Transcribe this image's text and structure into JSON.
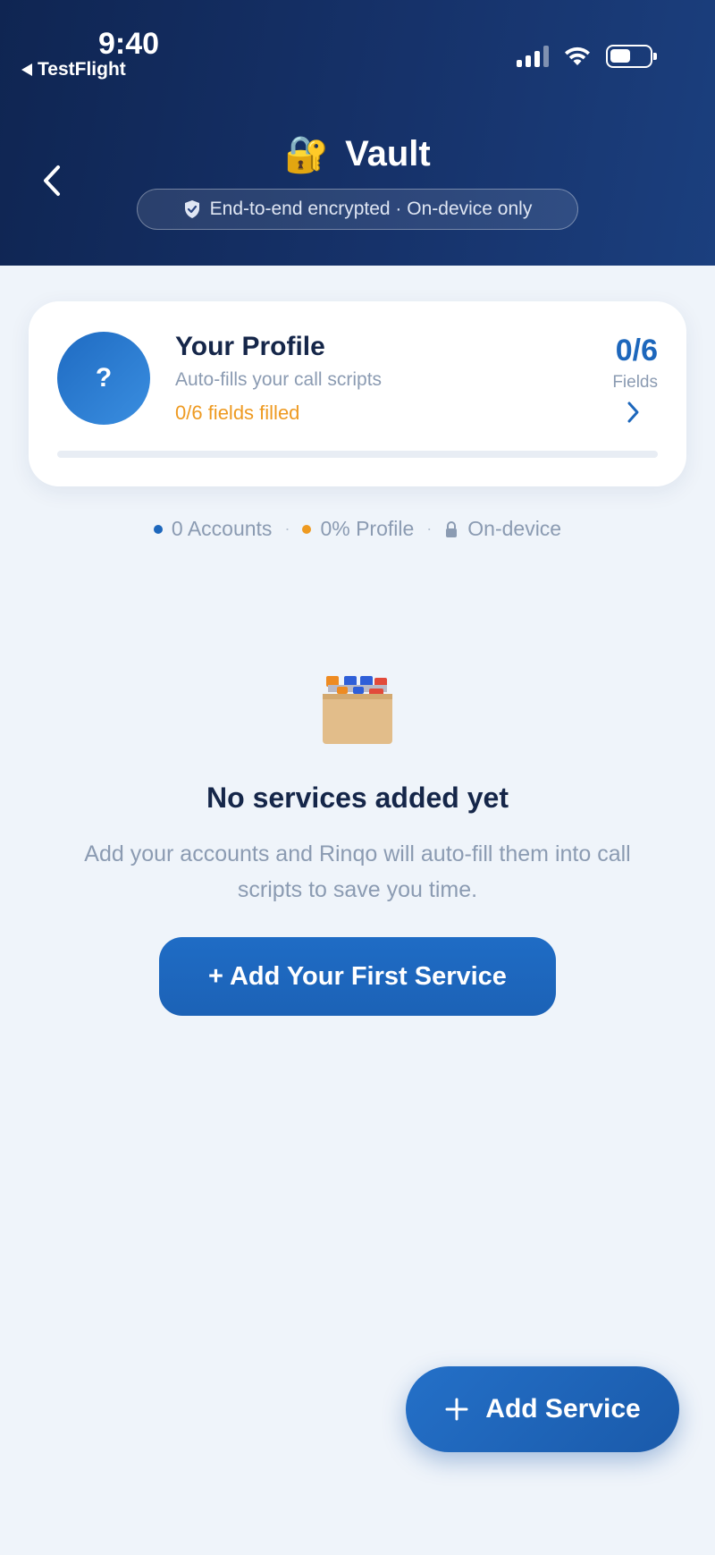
{
  "status_bar": {
    "time": "9:40",
    "back_app": "TestFlight"
  },
  "header": {
    "title": "Vault",
    "lock_emoji": "🔐",
    "encryption_note": "End-to-end encrypted · On-device only"
  },
  "profile": {
    "avatar_text": "?",
    "title": "Your Profile",
    "subtitle": "Auto-fills your call scripts",
    "filled_text": "0/6 fields filled",
    "count": "0/6",
    "count_label": "Fields",
    "progress": 0
  },
  "stats": {
    "accounts": "0 Accounts",
    "profile": "0% Profile",
    "device": "On-device",
    "separator": "·"
  },
  "empty_state": {
    "title": "No services added yet",
    "description": "Add your accounts and Rinqo will auto-fill them into call scripts to save you time.",
    "button_label": "+ Add Your First Service"
  },
  "fab": {
    "label": "Add Service"
  },
  "colors": {
    "header_bg": "#16326a",
    "accent_blue": "#1d67bc",
    "accent_orange": "#ee9a21",
    "background": "#eff4fa"
  }
}
